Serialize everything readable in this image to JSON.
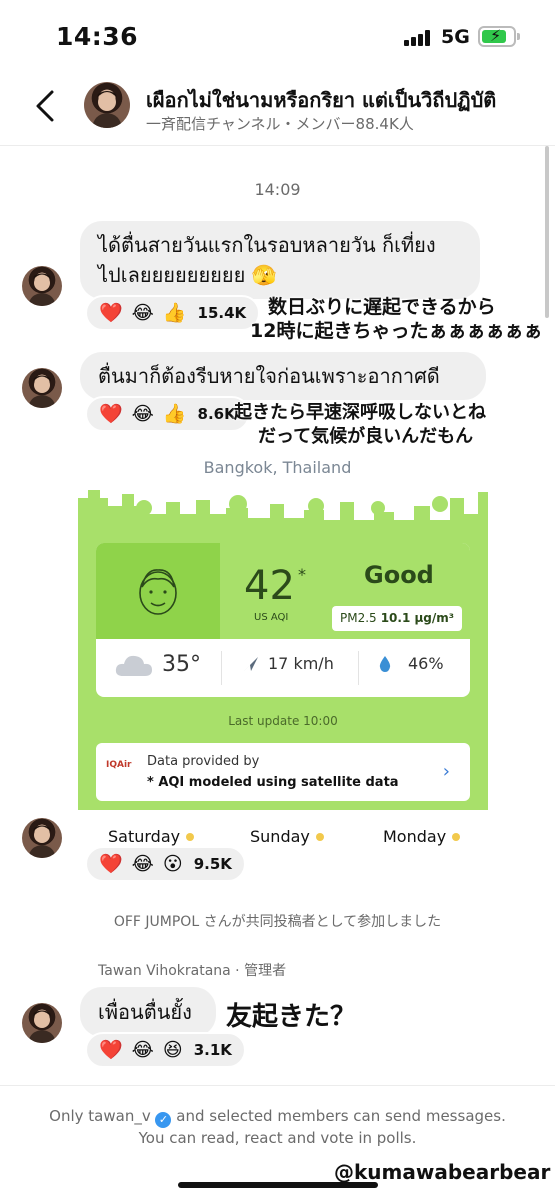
{
  "status_bar": {
    "time": "14:36",
    "network": "5G",
    "battery_color": "#30c84b"
  },
  "header": {
    "back_icon": "chevron-left-icon",
    "title": "เผือกไม่ใช่นามหรือกริยา แต่เป็นวิถีปฏิบัติ",
    "subtitle": "一斉配信チャンネル・メンバー88.4K人"
  },
  "timestamp": "14:09",
  "messages": [
    {
      "text_line1": "ได้ตื่นสายวันแรกในรอบหลายวัน ก็เที่ยง",
      "text_line2": "ไปเลยยยยยยยยย 🫣",
      "reactions": [
        "❤️",
        "😂",
        "👍"
      ],
      "count": "15.4K",
      "overlay_line1": "数日ぶりに遅起できるから",
      "overlay_line2": "12時に起きちゃったぁぁぁぁぁぁ"
    },
    {
      "text_line1": "ตื่นมาก็ต้องรีบหายใจก่อนเพราะอากาศดี",
      "reactions": [
        "❤️",
        "😂",
        "👍"
      ],
      "count": "8.6K",
      "overlay_line1": "起きたら早速深呼吸しないとね",
      "overlay_line2": "だって気候が良いんだもん"
    }
  ],
  "air_quality": {
    "location": "Bangkok, Thailand",
    "aqi": "42",
    "aqi_star": "*",
    "aqi_unit": "US AQI",
    "status": "Good",
    "pm_label": "PM2.5",
    "pm_value": "10.1 µg/m³",
    "temperature": "35°",
    "wind": "17 km/h",
    "humidity": "46%",
    "last_update": "Last update 10:00",
    "provider_logo": "IQAir",
    "provider_line1": "Data provided by",
    "provider_line2": "* AQI modeled using satellite data",
    "panel_color": "#a8e06a"
  },
  "days": {
    "day1": "Saturday",
    "day2": "Sunday",
    "day3": "Monday"
  },
  "aq_reactions": {
    "emojis": [
      "❤️",
      "😂",
      "😮"
    ],
    "count": "9.5K"
  },
  "system_message": "OFF JUMPOL さんが共同投稿者として参加しました",
  "sender_label": "Tawan Vihokratana · 管理者",
  "last_message": {
    "text": "เพื่อนตื่นยั้ง",
    "reactions": [
      "❤️",
      "😂",
      "😆"
    ],
    "count": "3.1K",
    "overlay": "友起きた？"
  },
  "footer": {
    "line1_a": "Only tawan_v",
    "line1_b": "and selected members can send messages.",
    "line2": "You can read, react and vote in polls.",
    "verified_color": "#3897f0"
  },
  "watermark": "@kumawabearbear"
}
